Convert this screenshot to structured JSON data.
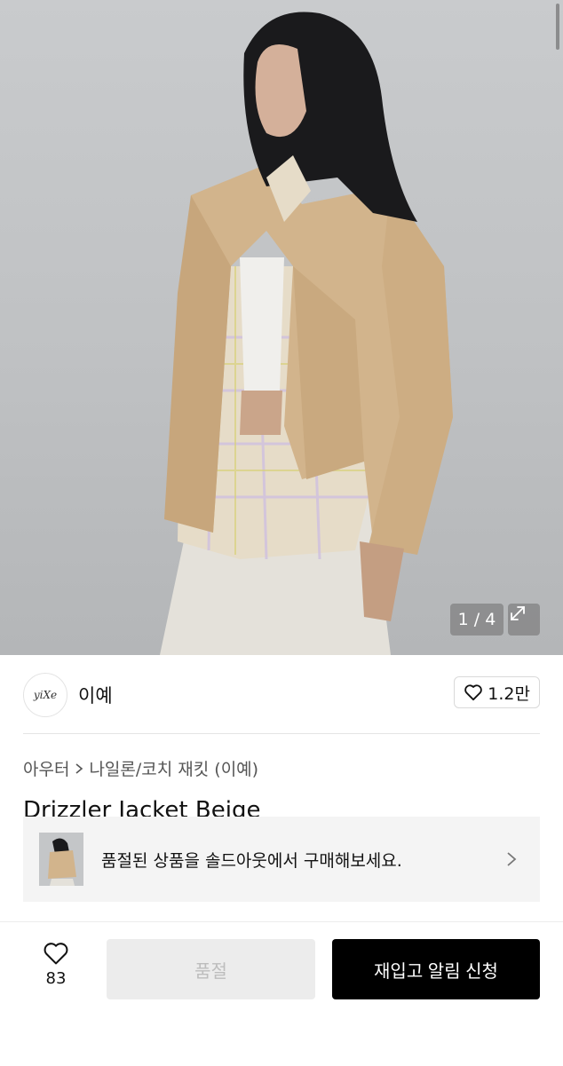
{
  "gallery": {
    "counter": "1 / 4",
    "expand_icon": "expand-arrows-icon"
  },
  "brand": {
    "logo_text": "yiXe",
    "name": "이예",
    "likes": "1.2만",
    "like_icon": "heart-outline-icon"
  },
  "breadcrumb": {
    "category": "아우터",
    "subcategory": "나일론/코치 재킷 (이예)",
    "separator_icon": "chevron-right-icon"
  },
  "product": {
    "title": "Drizzler Jacket Beige"
  },
  "soldout_banner": {
    "text": "품절된 상품을 솔드아웃에서 구매해보세요.",
    "chevron_icon": "chevron-right-icon"
  },
  "bottom_bar": {
    "wish_count": "83",
    "wish_icon": "heart-outline-icon",
    "soldout_label": "품절",
    "restock_label": "재입고 알림 신청"
  },
  "colors": {
    "jacket": "#d2b48c",
    "background": "#c9cbcd",
    "primary_button": "#000000",
    "disabled_button": "#ececec"
  }
}
